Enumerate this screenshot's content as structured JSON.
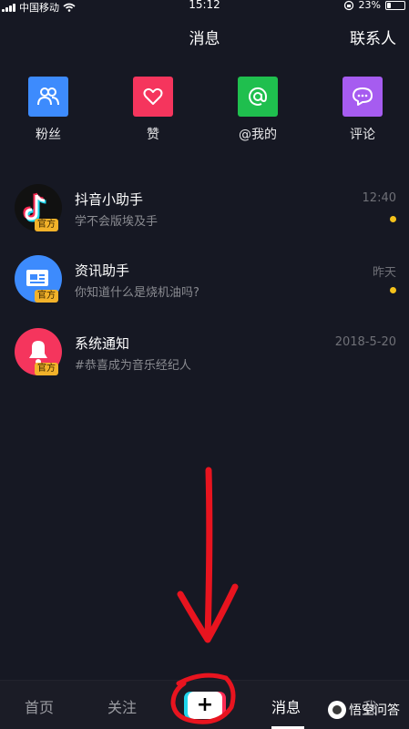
{
  "status_bar": {
    "carrier": "中国移动",
    "time": "15:12",
    "battery": "23%",
    "battery_level": 0.23
  },
  "header": {
    "title": "消息",
    "contacts": "联系人"
  },
  "quick_actions": [
    {
      "label": "粉丝",
      "icon": "fans-icon",
      "color": "#3d8bfd"
    },
    {
      "label": "赞",
      "icon": "heart-icon",
      "color": "#f5355d"
    },
    {
      "label": "@我的",
      "icon": "at-icon",
      "color": "#1fbf4e"
    },
    {
      "label": "评论",
      "icon": "comment-icon",
      "color": "#a65cf0"
    }
  ],
  "badge_label": "官方",
  "messages": [
    {
      "name": "抖音小助手",
      "preview": "学不会版埃及手",
      "time": "12:40",
      "unread": true
    },
    {
      "name": "资讯助手",
      "preview": "你知道什么是烧机油吗?",
      "time": "昨天",
      "unread": true
    },
    {
      "name": "系统通知",
      "preview": "#恭喜成为音乐经纪人",
      "time": "2018-5-20",
      "unread": false
    }
  ],
  "tabs": {
    "home": "首页",
    "follow": "关注",
    "create": "+",
    "messages": "消息",
    "me": "我"
  },
  "watermark": "悟空问答",
  "colors": {
    "background": "#161823",
    "unread_dot": "#f5c21b",
    "annotation": "#e8141f"
  }
}
